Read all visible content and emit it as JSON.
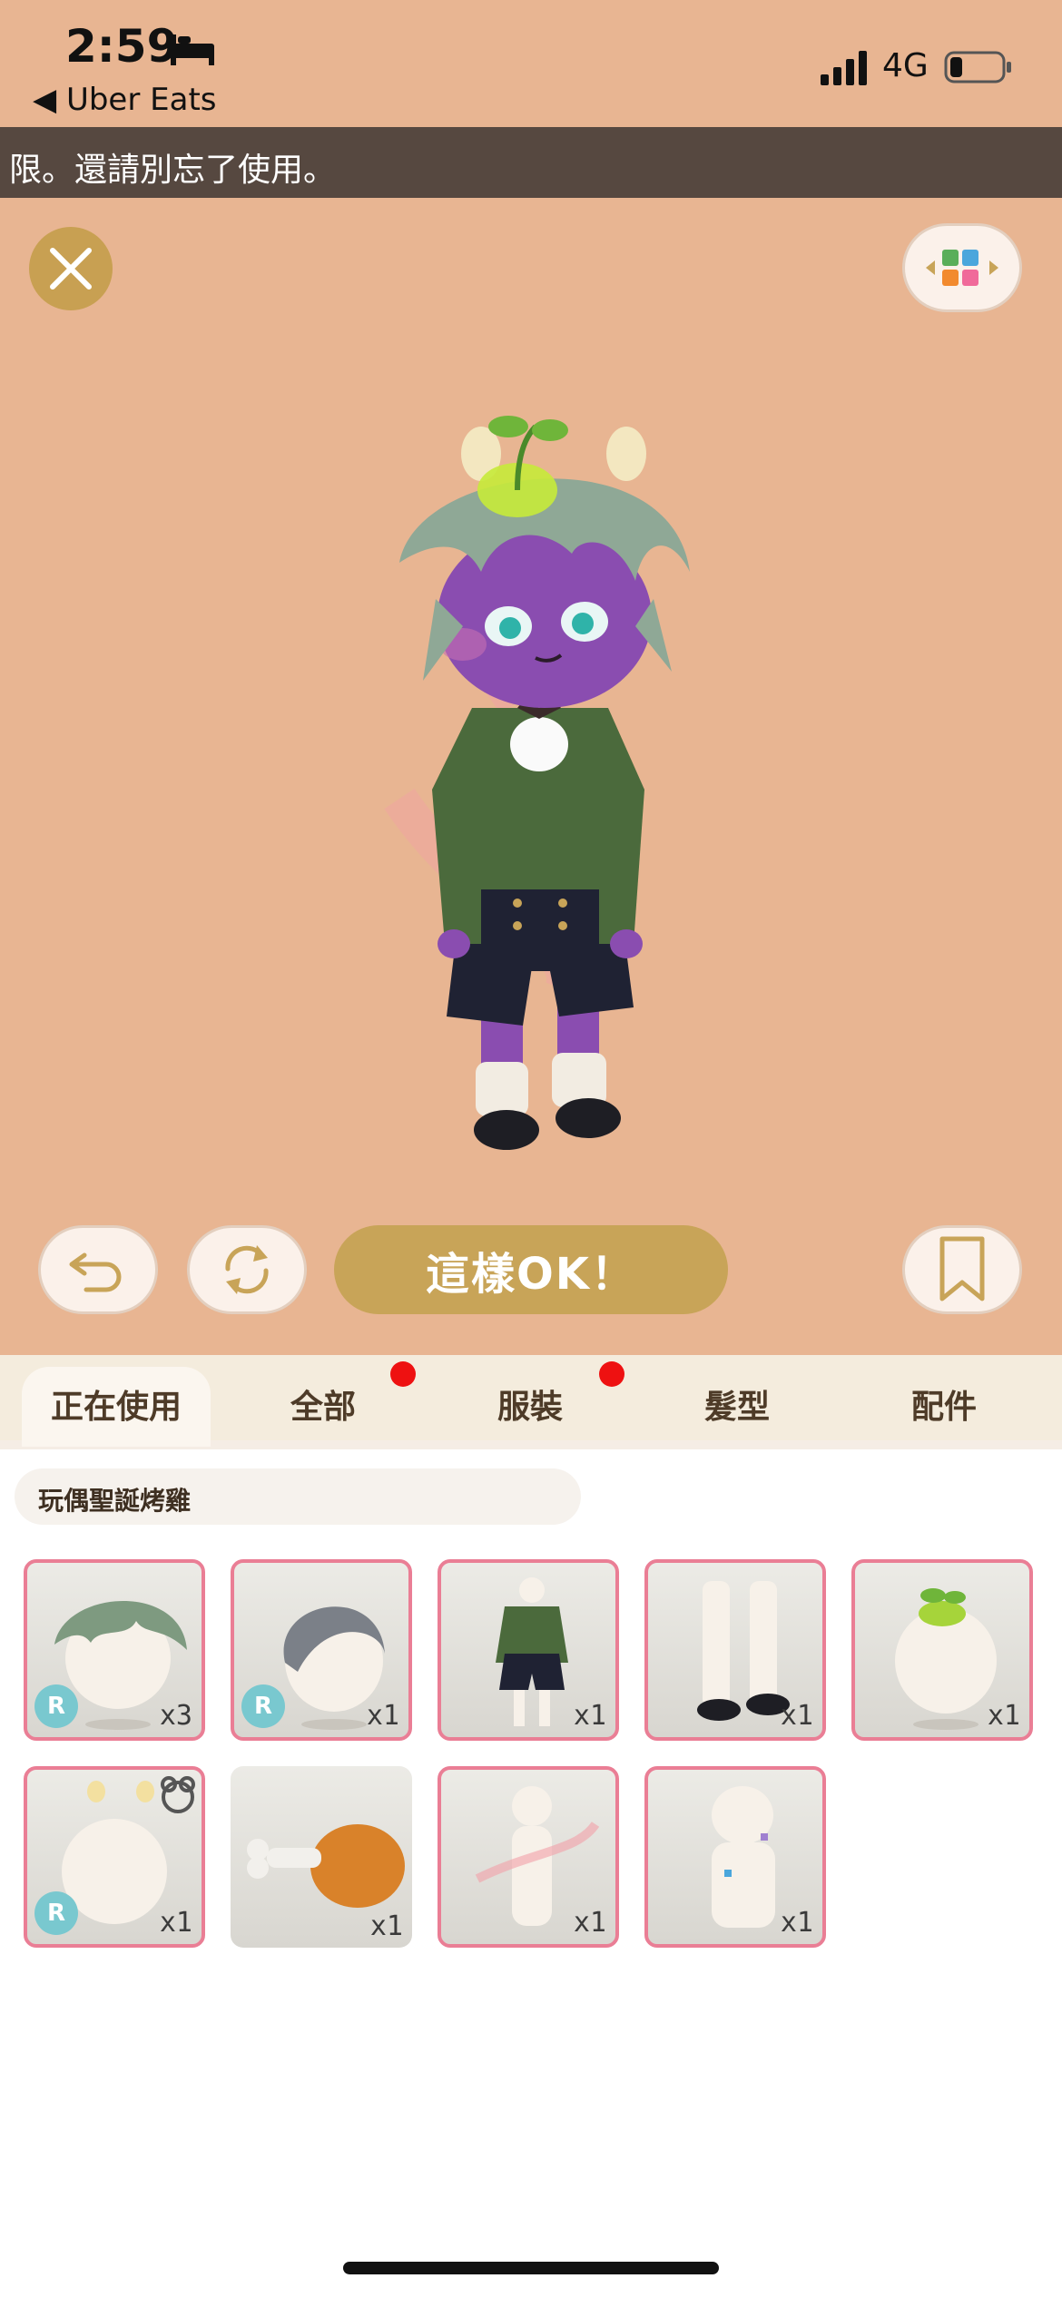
{
  "status_bar": {
    "time": "2:59",
    "back_app": "◀ Uber Eats",
    "network": "4G"
  },
  "banner": {
    "text": "限。還請別忘了使用。"
  },
  "actions": {
    "ok_label": "這樣OK！"
  },
  "tabs": [
    {
      "label": "正在使用",
      "active": true,
      "badge": false
    },
    {
      "label": "全部",
      "active": false,
      "badge": true
    },
    {
      "label": "服裝",
      "active": false,
      "badge": true
    },
    {
      "label": "髮型",
      "active": false,
      "badge": false
    },
    {
      "label": "配件",
      "active": false,
      "badge": false
    }
  ],
  "outfit": {
    "name": "玩偶聖誕烤雞"
  },
  "items": [
    {
      "kind": "leaf-hair",
      "rarity": "R",
      "qty": "x3"
    },
    {
      "kind": "gray-hair",
      "rarity": "R",
      "qty": "x1"
    },
    {
      "kind": "outfit",
      "rarity": "",
      "qty": "x1"
    },
    {
      "kind": "socks-shoes",
      "rarity": "",
      "qty": "x1"
    },
    {
      "kind": "sprout-head",
      "rarity": "",
      "qty": "x1"
    },
    {
      "kind": "ears-head",
      "rarity": "R",
      "qty": "x1"
    },
    {
      "kind": "drumstick",
      "rarity": "",
      "qty": "x1"
    },
    {
      "kind": "pink-aura",
      "rarity": "",
      "qty": "x1"
    },
    {
      "kind": "stickers",
      "rarity": "",
      "qty": "x1"
    }
  ],
  "colors": {
    "background": "#e8b592",
    "banner": "#564840",
    "accent_gold": "#c8a458",
    "tile_border": "#ea7e95",
    "badge_dot": "#ee1111",
    "rarity_badge": "#79c8cf"
  }
}
